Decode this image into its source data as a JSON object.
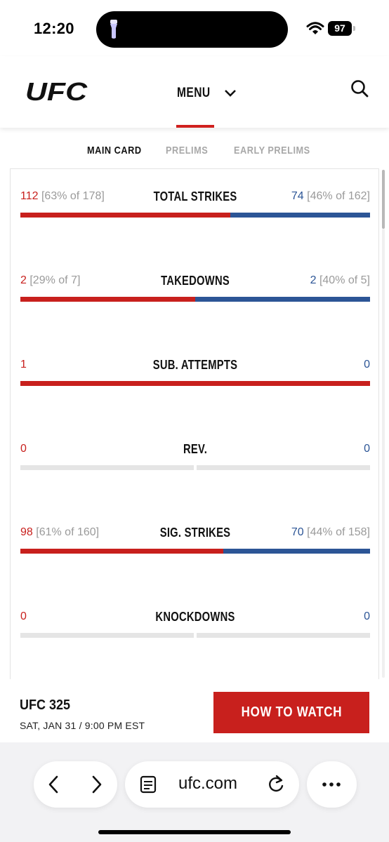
{
  "status_bar": {
    "time": "12:20",
    "battery": "97"
  },
  "header": {
    "logo_text": "UFC",
    "menu_label": "MENU"
  },
  "tabs": [
    {
      "label": "MAIN CARD",
      "active": true
    },
    {
      "label": "PRELIMS",
      "active": false
    },
    {
      "label": "EARLY PRELIMS",
      "active": false
    }
  ],
  "colors": {
    "red": "#c8201d",
    "blue": "#2c5596",
    "empty": "#e5e5e5"
  },
  "stats": [
    {
      "title": "TOTAL STRIKES",
      "red_value": "112",
      "red_detail": "[63% of 178]",
      "blue_value": "74",
      "blue_detail": "[46% of 162]",
      "red_share": 0.6
    },
    {
      "title": "TAKEDOWNS",
      "red_value": "2",
      "red_detail": "[29% of 7]",
      "blue_value": "2",
      "blue_detail": "[40% of 5]",
      "red_share": 0.5
    },
    {
      "title": "SUB. ATTEMPTS",
      "red_value": "1",
      "red_detail": "",
      "blue_value": "0",
      "blue_detail": "",
      "red_share": 1.0
    },
    {
      "title": "REV.",
      "red_value": "0",
      "red_detail": "",
      "blue_value": "0",
      "blue_detail": "",
      "red_share": null
    },
    {
      "title": "SIG. STRIKES",
      "red_value": "98",
      "red_detail": "[61% of 160]",
      "blue_value": "70",
      "blue_detail": "[44% of 158]",
      "red_share": 0.58
    },
    {
      "title": "KNOCKDOWNS",
      "red_value": "0",
      "red_detail": "",
      "blue_value": "0",
      "blue_detail": "",
      "red_share": null
    }
  ],
  "event": {
    "name": "UFC 325",
    "date": "SAT, JAN 31 / 9:00 PM EST",
    "cta": "HOW TO WATCH"
  },
  "browser": {
    "url": "ufc.com"
  }
}
